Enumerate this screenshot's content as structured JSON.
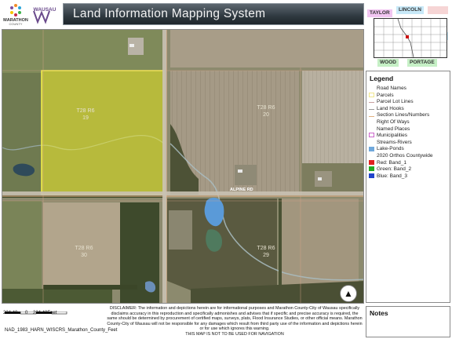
{
  "header": {
    "title": "Land Information Mapping System",
    "logo_marathon_text": "MARATHON",
    "logo_marathon_sub": "COUNTY",
    "logo_wausau_text": "WAUSAU"
  },
  "map": {
    "road_label": "ALPINE RD",
    "section_labels": [
      {
        "line1": "T28 R6",
        "line2": "19"
      },
      {
        "line1": "T28 R6",
        "line2": "20"
      },
      {
        "line1": "T28 R6",
        "line2": "30"
      },
      {
        "line1": "T28 R6",
        "line2": "29"
      }
    ],
    "north_arrow": "▲",
    "selection_color": "#f2ee3a"
  },
  "locator": {
    "labels": [
      "TAYLOR",
      "LINCOLN",
      "WOOD",
      "PORTAGE"
    ]
  },
  "legend": {
    "title": "Legend",
    "items": [
      {
        "label": "Road Names",
        "swatch": "none",
        "color": "#ffffff"
      },
      {
        "label": "Parcels",
        "swatch": "box",
        "color": "#f0e68c"
      },
      {
        "label": "Parcel Lot Lines",
        "swatch": "line",
        "color": "#c8a0a0"
      },
      {
        "label": "Land Hooks",
        "swatch": "line",
        "color": "#999999"
      },
      {
        "label": "Section Lines/Numbers",
        "swatch": "line",
        "color": "#e0b080"
      },
      {
        "label": "Right Of Ways",
        "swatch": "none",
        "color": "#ffffff"
      },
      {
        "label": "Named Places",
        "swatch": "none",
        "color": "#ffffff"
      },
      {
        "label": "Municipalities",
        "swatch": "box",
        "color": "#cc66cc"
      },
      {
        "label": "Streams-Rivers",
        "swatch": "none",
        "color": "#ffffff"
      },
      {
        "label": "Lake-Ponds",
        "swatch": "fill",
        "color": "#6fa8dc"
      },
      {
        "label": "2020 Orthos Countywide",
        "swatch": "none",
        "color": "#ffffff"
      },
      {
        "label": "Red:   Band_1",
        "swatch": "fill",
        "color": "#e02020"
      },
      {
        "label": "Green: Band_2",
        "swatch": "fill",
        "color": "#22aa22"
      },
      {
        "label": "Blue:  Band_3",
        "swatch": "fill",
        "color": "#2244cc"
      }
    ]
  },
  "notes": {
    "title": "Notes"
  },
  "footer": {
    "scale_left": "224.40",
    "scale_mid": "0",
    "scale_right": "224.40Feet",
    "projection": "NAD_1983_HARN_WISCRS_Marathon_County_Feet",
    "disclaimer": "DISCLAIMER: The information and depictions herein are for informational purposes and Marathon County-City of Wausau specifically disclaims accuracy in this reproduction and specifically admonishes and advises that if specific and precise accuracy is required, the same should be determined by procurement of certified maps, surveys, plats, Flood Insurance Studies, or other official means. Marathon County-City of Wausau will not be responsible for any damages which result from third party use of the information and depictions herein or for use which ignores this warning.",
    "navigation_warning": "THIS MAP IS NOT TO BE USED FOR NAVIGATION"
  }
}
